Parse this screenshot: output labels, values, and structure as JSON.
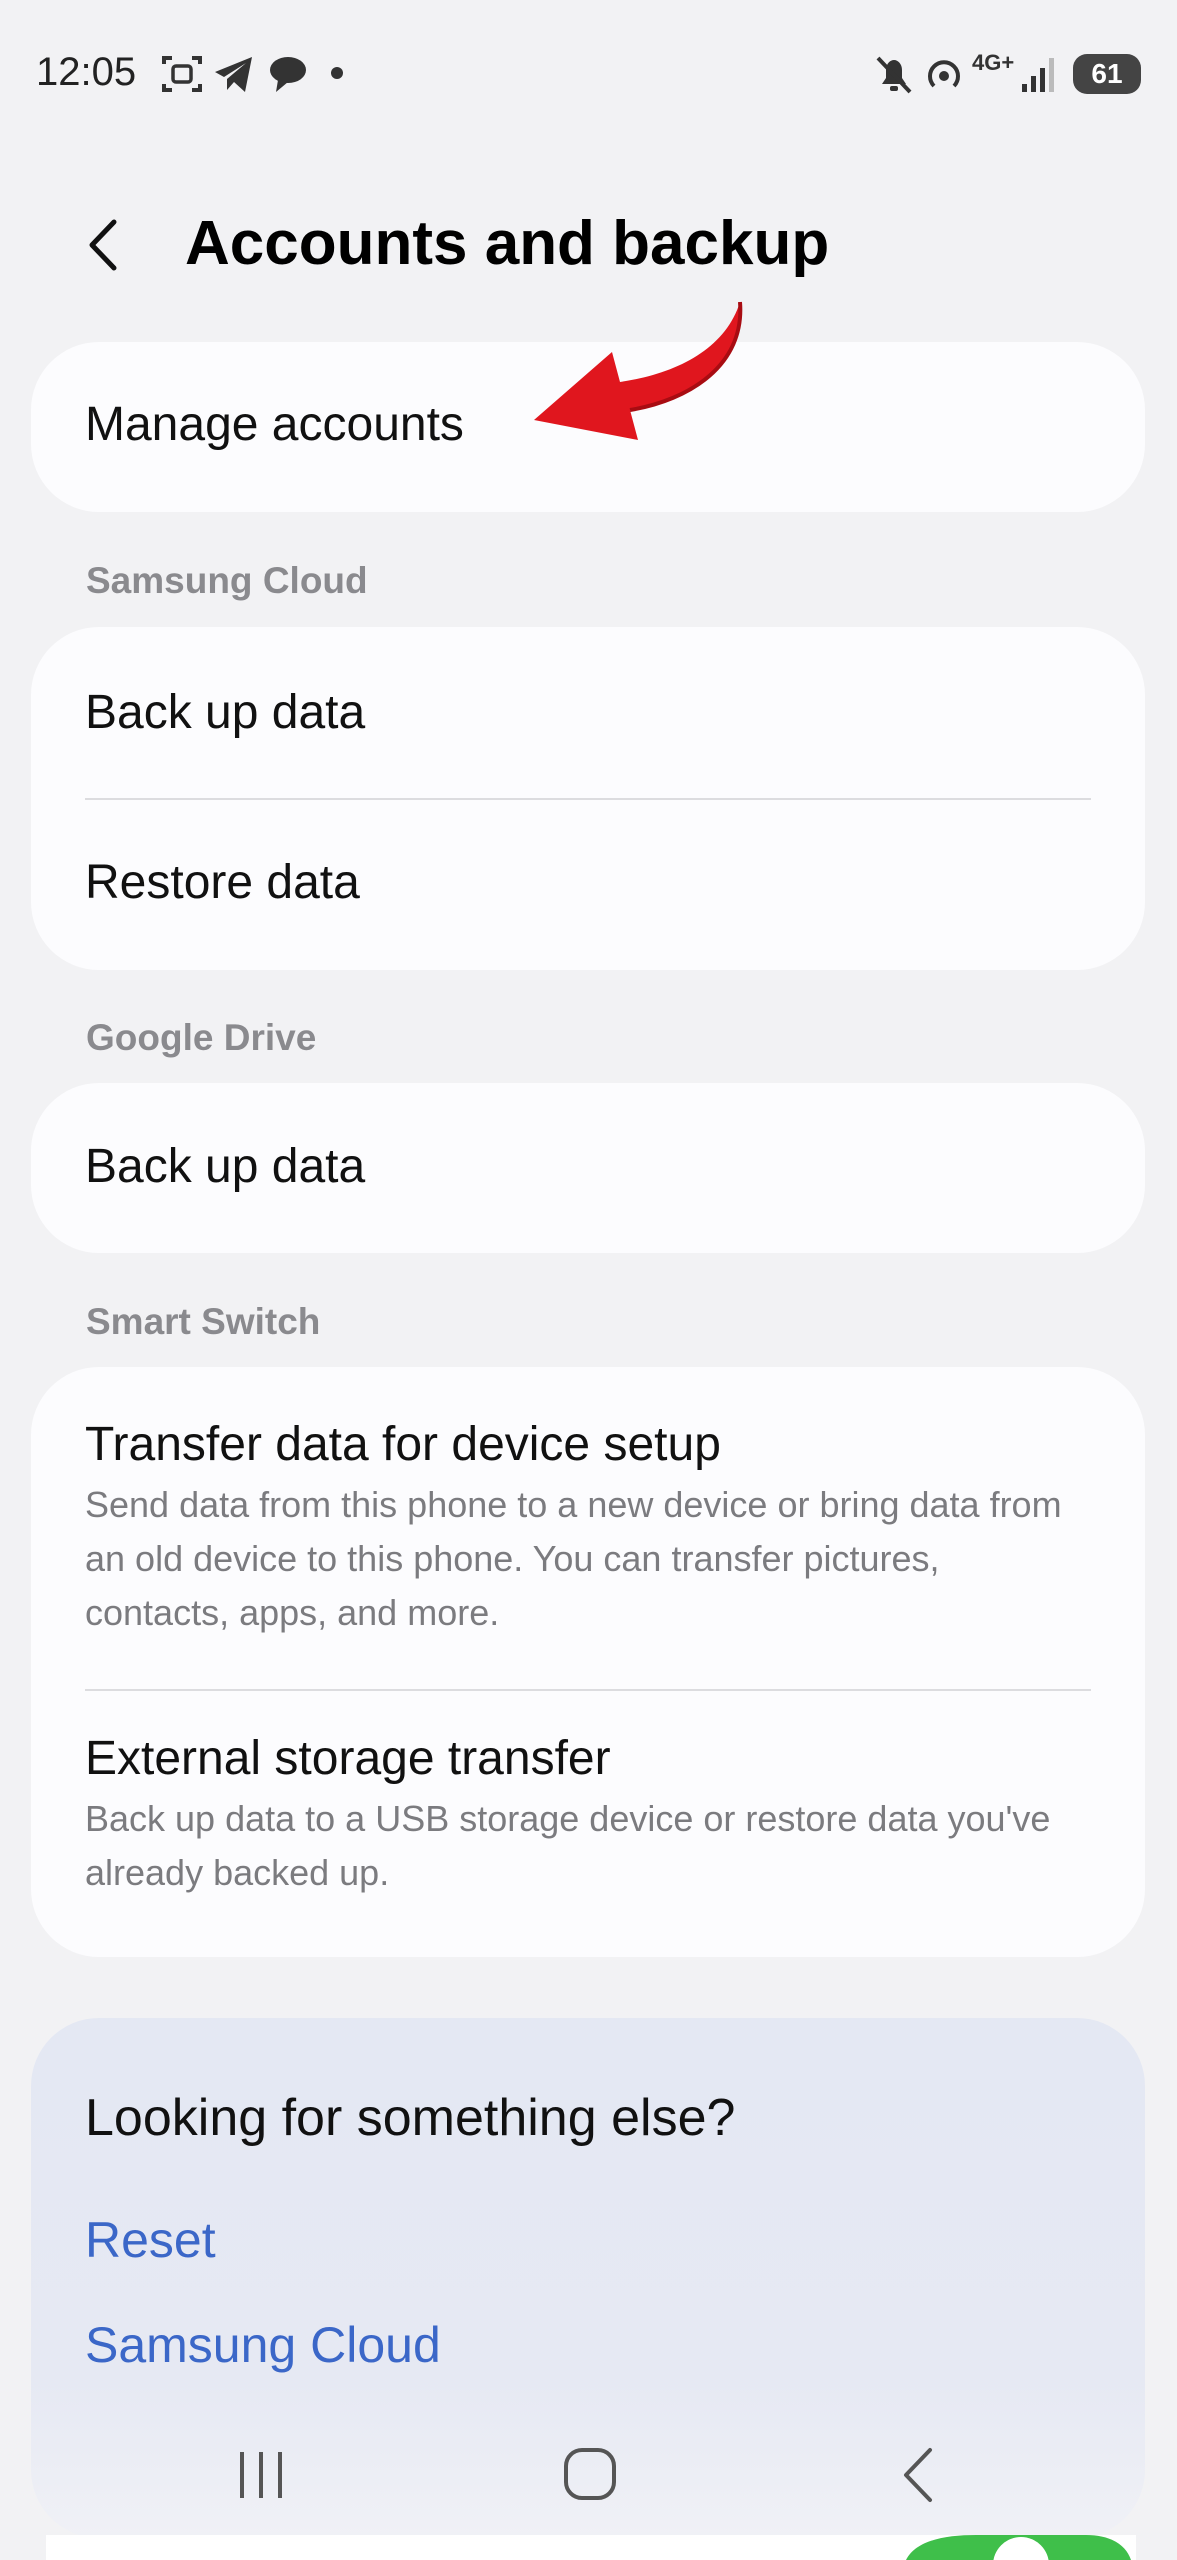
{
  "status_bar": {
    "time": "12:05",
    "battery": "61",
    "network": "4G+",
    "left_icons": [
      "screenshot-icon",
      "telegram-icon",
      "chat-icon",
      "dot-icon"
    ],
    "right_icons": [
      "mute-icon",
      "hotspot-icon",
      "network-4g-icon",
      "signal-icon",
      "battery-icon"
    ]
  },
  "header": {
    "title": "Accounts and backup",
    "back_icon": "chevron-left-icon"
  },
  "manage_accounts": {
    "label": "Manage accounts",
    "annotation": "red-arrow-icon"
  },
  "samsung_cloud": {
    "section_label": "Samsung Cloud",
    "items": [
      {
        "label": "Back up data"
      },
      {
        "label": "Restore data"
      }
    ]
  },
  "google_drive": {
    "section_label": "Google Drive",
    "items": [
      {
        "label": "Back up data"
      }
    ]
  },
  "smart_switch": {
    "section_label": "Smart Switch",
    "items": [
      {
        "label": "Transfer data for device setup",
        "description": "Send data from this phone to a new device or bring data from an old device to this phone. You can transfer pictures, contacts, apps, and more."
      },
      {
        "label": "External storage transfer",
        "description": "Back up data to a USB storage device or restore data you've already backed up."
      }
    ]
  },
  "help": {
    "title": "Looking for something else?",
    "links": [
      "Reset",
      "Samsung Cloud"
    ]
  },
  "nav_bar": {
    "buttons": [
      "recents-icon",
      "home-icon",
      "back-icon"
    ]
  },
  "colors": {
    "background": "#f2f2f4",
    "card": "#fcfcfe",
    "link": "#3b67c8",
    "section_label": "#8a8a8e",
    "arrow": "#e0161e"
  }
}
